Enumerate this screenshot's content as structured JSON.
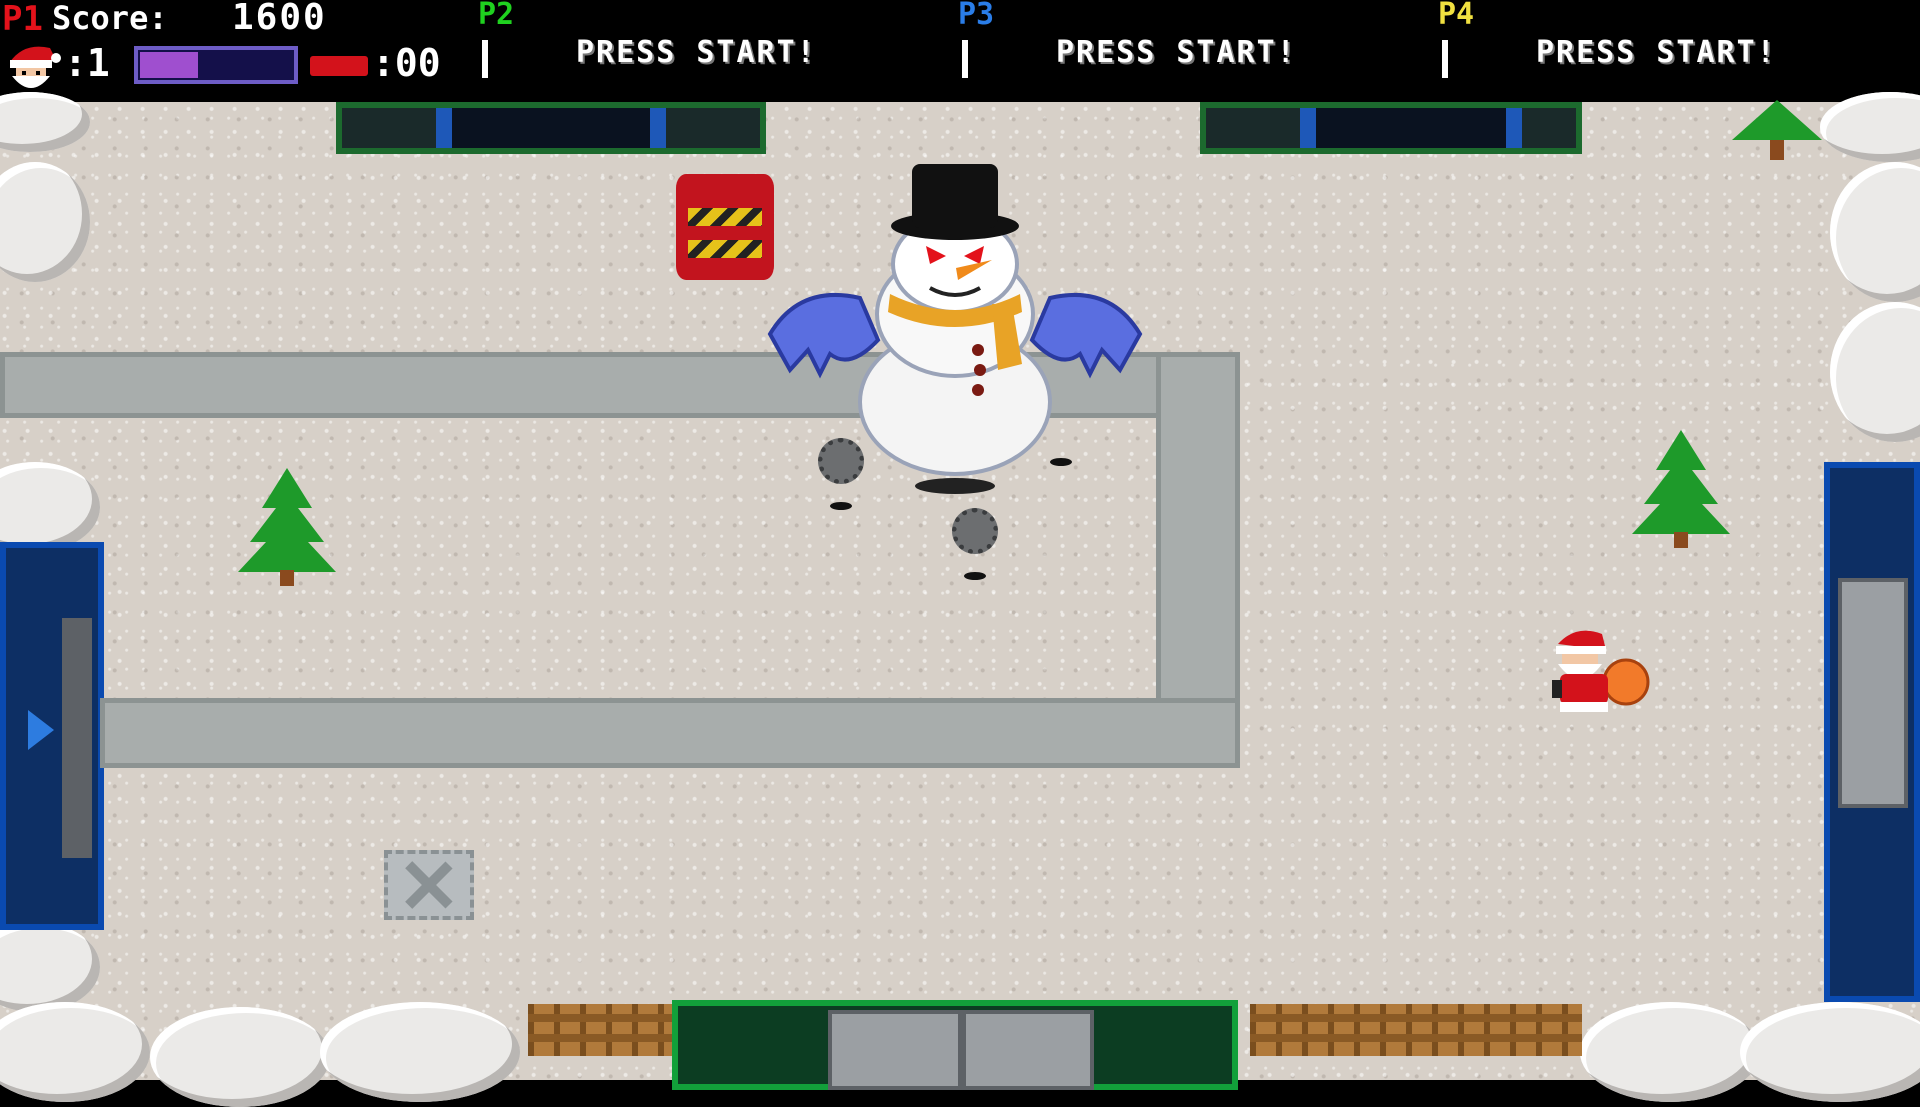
{
  "hud": {
    "p1": {
      "tag": "P1",
      "score_label": "Score:",
      "score_value": "1600",
      "lives": ":1",
      "health_fraction": 0.38,
      "bombs": ":00",
      "tag_color": "#e3121b",
      "health_color": "#9f4fcf",
      "bomb_color": "#d3121b"
    },
    "p2": {
      "tag": "P2",
      "prompt": "PRESS START!",
      "tag_color": "#1fd11f"
    },
    "p3": {
      "tag": "P3",
      "prompt": "PRESS START!",
      "tag_color": "#2a7de8"
    },
    "p4": {
      "tag": "P4",
      "prompt": "PRESS START!",
      "tag_color": "#f0e040"
    }
  },
  "icons": {
    "lives": "santa-head-icon",
    "bombs": "bomb-icon",
    "player": "santa-with-sack",
    "boss": "evil-snowman-boss",
    "hazard": "spiked-mine",
    "prop": "red-explosive-barrel",
    "decor": "pine-tree"
  }
}
